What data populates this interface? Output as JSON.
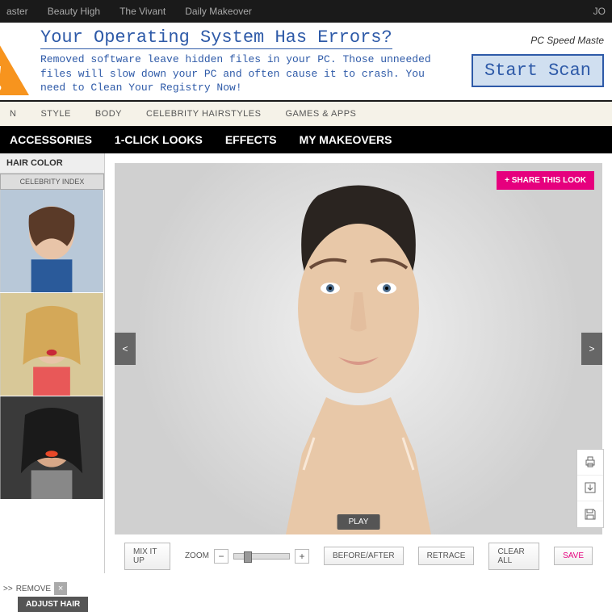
{
  "topbar": {
    "links": [
      "aster",
      "Beauty High",
      "The Vivant",
      "Daily Makeover"
    ],
    "right": "JO"
  },
  "ad": {
    "title": "Your Operating System Has Errors?",
    "body": "Removed software leave hidden files in your PC. Those unneeded files will slow down your PC and often cause it to crash. You need to Clean Your Registry Now!",
    "label": "PC Speed Maste",
    "button": "Start Scan"
  },
  "nav1": [
    "N",
    "STYLE",
    "BODY",
    "CELEBRITY HAIRSTYLES",
    "GAMES & APPS"
  ],
  "nav2": [
    "ACCESSORIES",
    "1-CLICK LOOKS",
    "EFFECTS",
    "MY MAKEOVERS"
  ],
  "sidebar": {
    "heading": "HAIR COLOR",
    "tab": "CELEBRITY INDEX"
  },
  "canvas": {
    "share": "+ SHARE THIS LOOK",
    "prev": "<",
    "next": ">",
    "play": "PLAY"
  },
  "controls": {
    "mix": "MIX IT UP",
    "zoom": "ZOOM",
    "before": "BEFORE/AFTER",
    "retrace": "RETRACE",
    "clear": "CLEAR ALL",
    "save": "SAVE"
  },
  "footer": {
    "arrows": ">>",
    "remove": "REMOVE",
    "adjust": "ADJUST HAIR"
  }
}
